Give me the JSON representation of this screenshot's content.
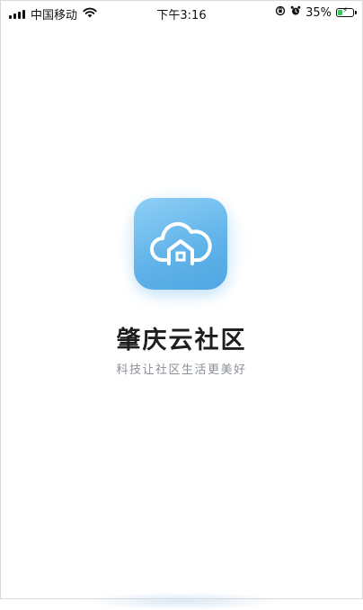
{
  "status_bar": {
    "carrier": "中国移动",
    "time": "下午3:16",
    "battery_percent": "35%",
    "battery_level": 0.35,
    "battery_color": "#34c759",
    "icons": [
      "signal-icon",
      "wifi-icon",
      "orientation-lock-icon",
      "alarm-icon",
      "battery-icon"
    ]
  },
  "app": {
    "icon": "cloud-house-icon",
    "name": "肇庆云社区",
    "slogan": "科技让社区生活更美好",
    "accent_color": "#5fb3ea"
  }
}
